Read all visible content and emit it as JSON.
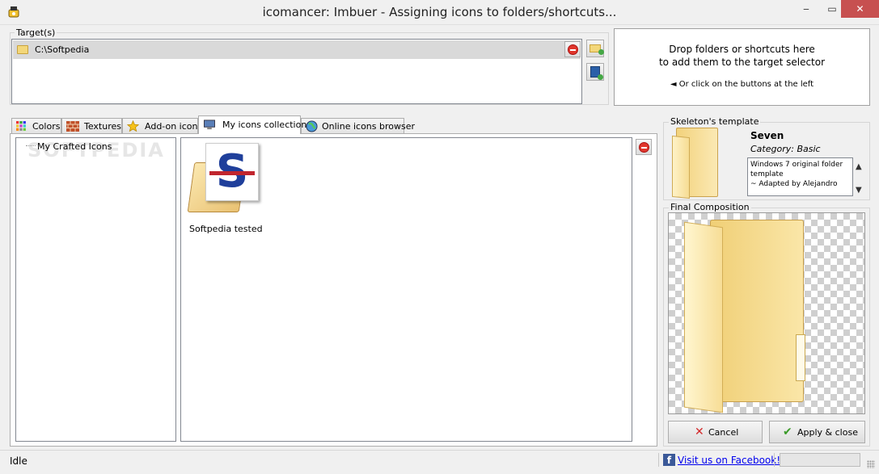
{
  "window": {
    "title": "icomancer: Imbuer - Assigning icons to folders/shortcuts...",
    "controls": {
      "minimize": "‒",
      "maximize": "▭",
      "close": "✕"
    }
  },
  "target": {
    "group_label": "Target(s)",
    "items": [
      {
        "path": "C:\\Softpedia",
        "icon": "folder-icon"
      }
    ]
  },
  "drop_zone": {
    "line1": "Drop folders or shortcuts here\nto add them to the target selector",
    "line2": "◄ Or click on the buttons at the left"
  },
  "tabs": [
    {
      "label": "Colors",
      "icon": "color-grid-icon",
      "active": false
    },
    {
      "label": "Textures",
      "icon": "brick-icon",
      "active": false
    },
    {
      "label": "Add-on icons",
      "icon": "star-icon",
      "active": false
    },
    {
      "label": "My icons collection",
      "icon": "monitor-icon",
      "active": true
    },
    {
      "label": "Online icons browser",
      "icon": "globe-icon",
      "active": false
    }
  ],
  "collection": {
    "watermark": "SOFTPEDIA",
    "tree_items": [
      "My Crafted Icons"
    ],
    "icons": [
      {
        "label": "Softpedia tested",
        "logo_letter": "S"
      }
    ]
  },
  "skeleton": {
    "group_label": "Skeleton's template",
    "name": "Seven",
    "category": "Category: Basic",
    "description": "Windows 7 original folder template\n~ Adapted by Alejandro"
  },
  "final": {
    "group_label": "Final Composition"
  },
  "actions": {
    "cancel": {
      "label": "Cancel",
      "icon": "x-red-icon"
    },
    "apply": {
      "label": "Apply & close",
      "icon": "checkmark-green-icon"
    }
  },
  "status": {
    "text": "Idle",
    "facebook_link": "Visit us on Facebook!",
    "progress": 0
  },
  "colors": {
    "close_button": "#c75050",
    "selection_row": "#d9d9d9",
    "link": "#0000ee",
    "facebook": "#3b5998"
  }
}
